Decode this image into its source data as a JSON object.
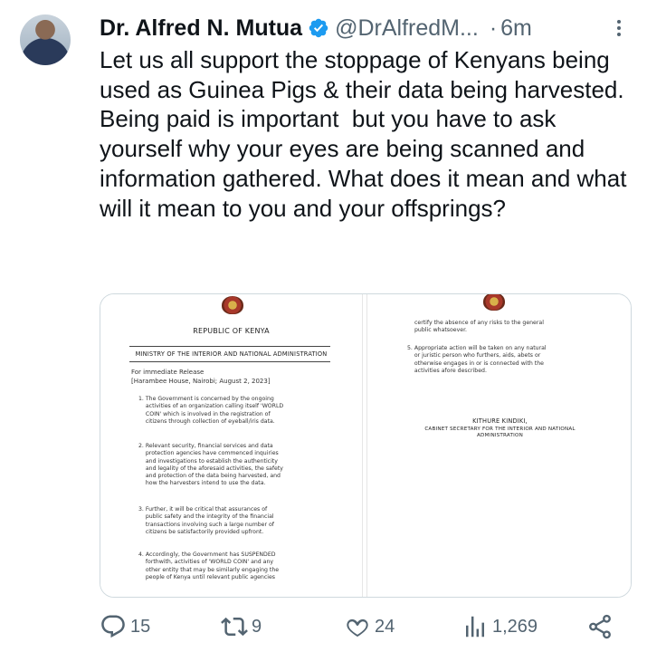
{
  "user": {
    "name": "Dr. Alfred N. Mutua",
    "handle": "@DrAlfredM...",
    "separator": "·",
    "time": "6m"
  },
  "tweet": {
    "text": "Let us all support the stoppage of Kenyans being used as Guinea Pigs & their data being harvested. Being paid is important  but you have to ask yourself why your eyes are being scanned and information gathered. What does it mean and what will it mean to you and your offsprings?"
  },
  "document": {
    "page1": {
      "republic": "REPUBLIC OF KENYA",
      "ministry": "MINISTRY OF THE INTERIOR AND NATIONAL ADMINISTRATION",
      "release": "For immediate Release",
      "dateline": "[Harambee House, Nairobi; August 2, 2023]",
      "para1": "1. The Government is concerned by the ongoing\n    activities of an organization calling itself 'WORLD\n    COIN' which is involved in the registration of\n    citizens through collection of eyeball/iris data.",
      "para2": "2. Relevant security, financial services and data\n    protection agencies have commenced inquiries\n    and investigations to establish the authenticity\n    and legality of the aforesaid activities, the safety\n    and protection of the data being harvested, and\n    how the harvesters intend to use the data.",
      "para3": "3. Further, it will be critical that assurances of\n    public safety and the integrity of the financial\n    transactions involving such a large number of\n    citizens be satisfactorily provided upfront.",
      "para4": "4. Accordingly, the Government has SUSPENDED\n    forthwith, activities of 'WORLD COIN' and any\n    other entity that may be similarly engaging the\n    people of Kenya until relevant public agencies"
    },
    "page2": {
      "cont": "certify the absence of any risks to the general\npublic whatsoever.",
      "para5": "5. Appropriate action will be taken on any natural\n    or juristic person who furthers, aids, abets or\n    otherwise engages in or is connected with the\n    activities afore described.",
      "signatory": "KITHURE KINDIKI,",
      "title": "CABINET SECRETARY FOR THE INTERIOR AND NATIONAL\nADMINISTRATION"
    }
  },
  "actions": {
    "replies": "15",
    "reposts": "9",
    "likes": "24",
    "views": "1,269"
  },
  "icons": {
    "verified": "verified-badge-icon",
    "reply": "reply-icon",
    "repost": "repost-icon",
    "like": "heart-icon",
    "views": "views-icon",
    "share": "share-icon"
  },
  "colors": {
    "verified": "#1d9bf0",
    "muted": "#536471",
    "text": "#0f1419"
  }
}
